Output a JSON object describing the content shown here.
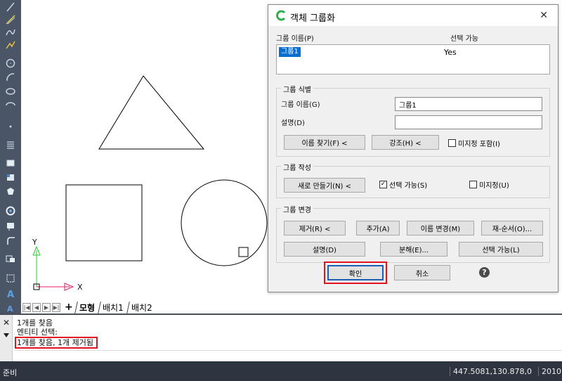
{
  "dialog": {
    "title": "객체 그룹화",
    "close_icon": "close-icon",
    "columns": {
      "name": "그룹 이름(P)",
      "selectable": "선택 가능"
    },
    "list_rows": [
      {
        "name": "그룹1",
        "selectable": "Yes"
      }
    ],
    "identify": {
      "title": "그룹 식별",
      "name_label": "그룹 이름(G)",
      "name_value": "그룹1",
      "desc_label": "설명(D)",
      "desc_value": "",
      "find_name_button": "이름 찾기(F) <",
      "highlight_button": "강조(H) <",
      "include_unnamed": "미지정 포함(I)"
    },
    "create": {
      "title": "그룹 작성",
      "new_button": "새로 만들기(N) <",
      "selectable_check": "선택 가능(S)",
      "unnamed_check": "미지정(U)"
    },
    "change": {
      "title": "그룹 변경",
      "remove_button": "제거(R) <",
      "add_button": "추가(A)",
      "rename_button": "이름 변경(M)",
      "reorder_button": "재-순서(O)...",
      "description_button": "설명(D)",
      "explode_button": "분해(E)...",
      "selectable_button": "선택 가능(L)"
    },
    "ok_button": "확인",
    "cancel_button": "취소",
    "help_icon": "help-icon"
  },
  "layout_tabs": {
    "model": "모형",
    "layout1": "배치1",
    "layout2": "배치2"
  },
  "command": {
    "lines": [
      "1개를 찾음",
      "엔티티 선택:",
      "1개를 찾음, 1개 제거됨"
    ]
  },
  "status": {
    "text": "준비",
    "coords": "447.5081,130.878,0",
    "year": "2010"
  },
  "ucs": {
    "x": "X",
    "y": "Y"
  },
  "colors": {
    "accent_red": "#e0141e",
    "selection_blue": "#0a6ed1",
    "status_bg": "#2e3440"
  }
}
